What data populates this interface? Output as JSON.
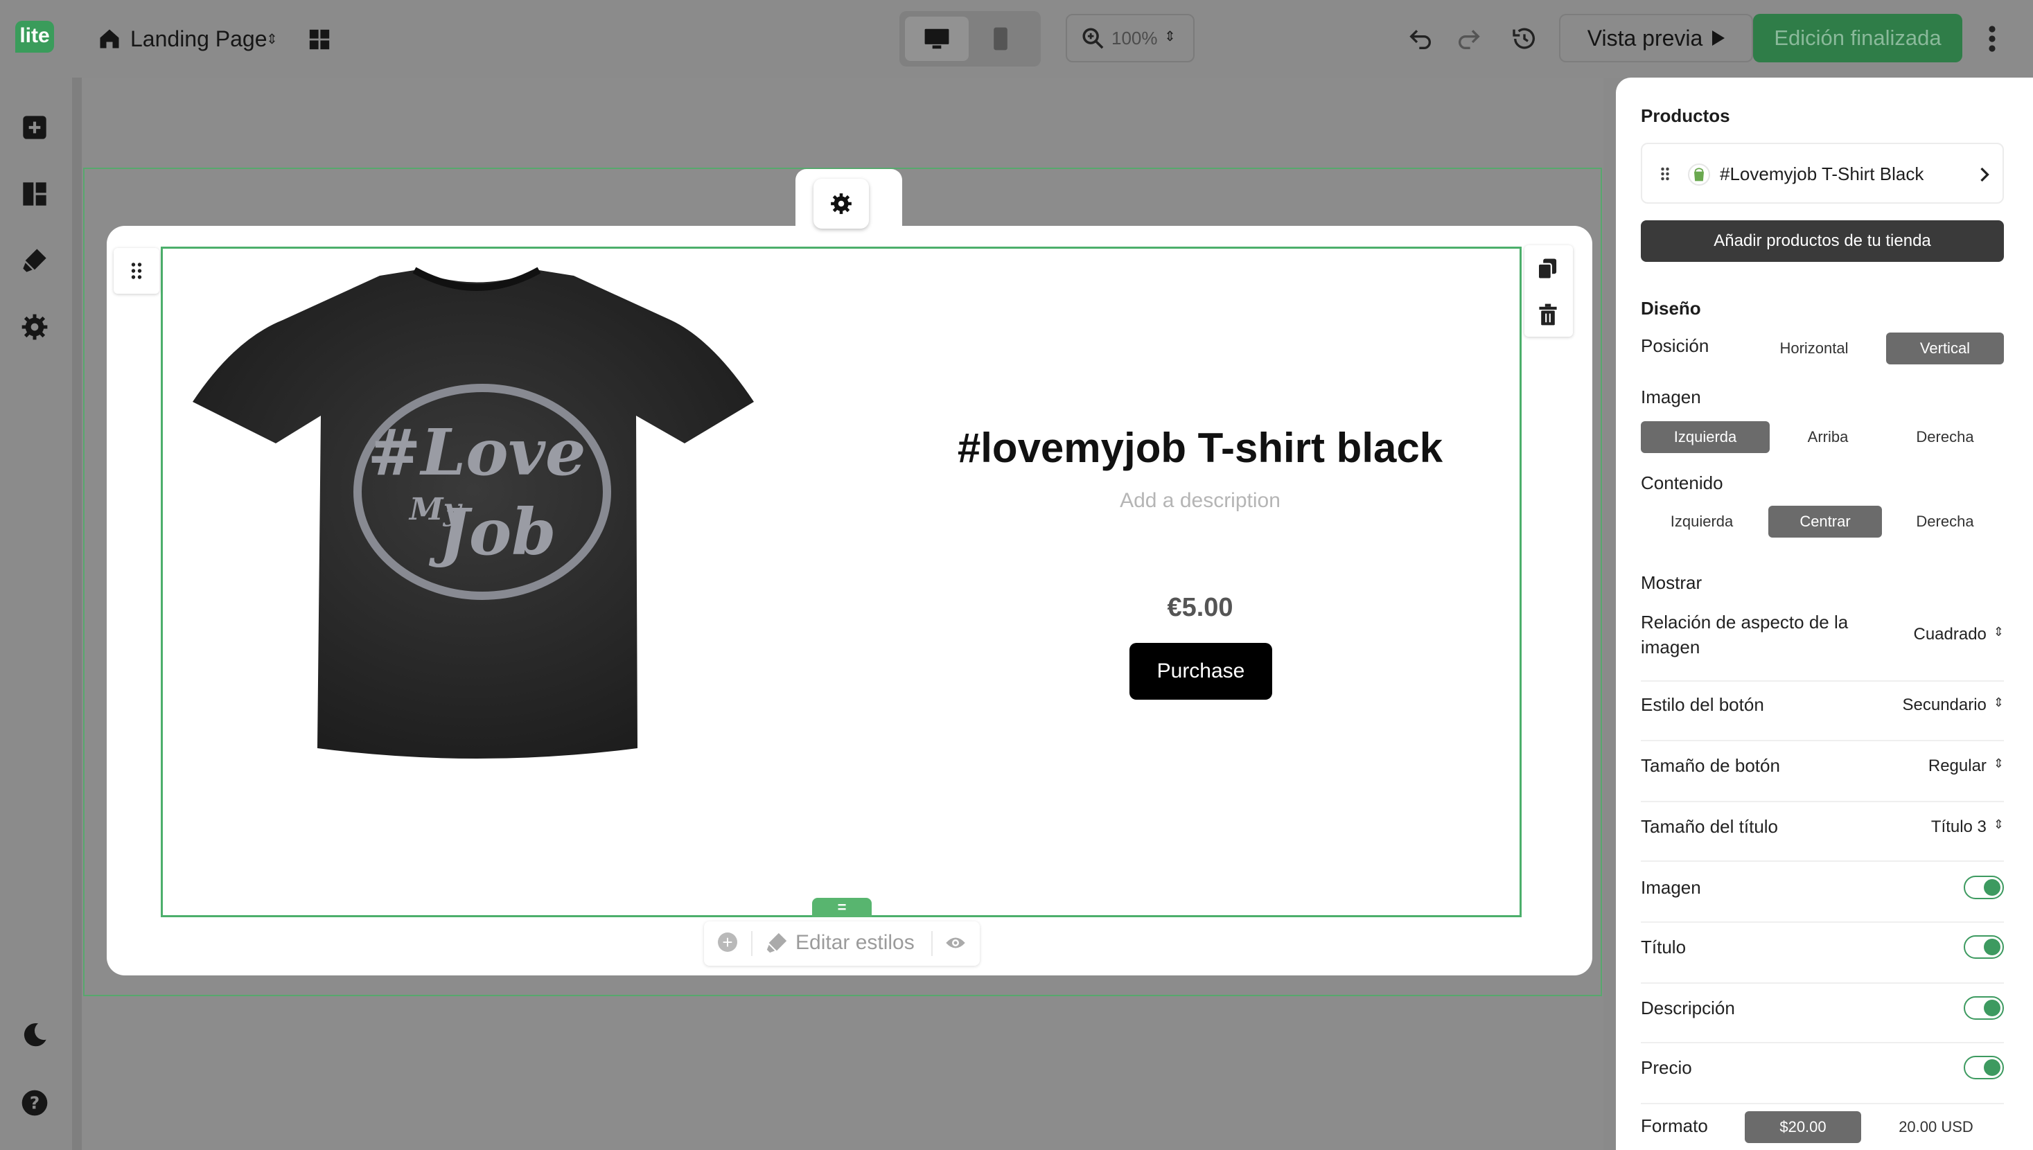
{
  "topbar": {
    "logo": "lite",
    "page_name": "Landing Page",
    "zoom": "100%",
    "preview_label": "Vista previa",
    "done_label": "Edición finalizada"
  },
  "canvas": {
    "product_title": "#lovemyjob T-shirt black",
    "description_placeholder": "Add a description",
    "price": "€5.00",
    "purchase_label": "Purchase",
    "resize_handle": "=",
    "edit_styles_label": "Editar estilos"
  },
  "panel": {
    "products_heading": "Productos",
    "product_item": "#Lovemyjob T-Shirt Black",
    "add_products_label": "Añadir productos de tu tienda",
    "design_heading": "Diseño",
    "position_label": "Posición",
    "position_options": [
      "Horizontal",
      "Vertical"
    ],
    "position_selected": "Vertical",
    "image_label": "Imagen",
    "image_options": [
      "Izquierda",
      "Arriba",
      "Derecha"
    ],
    "image_selected": "Izquierda",
    "content_label": "Contenido",
    "content_options": [
      "Izquierda",
      "Centrar",
      "Derecha"
    ],
    "content_selected": "Centrar",
    "show_heading": "Mostrar",
    "aspect_label": "Relación de aspecto de la imagen",
    "aspect_value": "Cuadrado",
    "button_style_label": "Estilo del botón",
    "button_style_value": "Secundario",
    "button_size_label": "Tamaño de botón",
    "button_size_value": "Regular",
    "title_size_label": "Tamaño del título",
    "title_size_value": "Título 3",
    "toggles": [
      {
        "label": "Imagen",
        "on": true
      },
      {
        "label": "Título",
        "on": true
      },
      {
        "label": "Descripción",
        "on": true
      },
      {
        "label": "Precio",
        "on": true
      }
    ],
    "format_label": "Formato",
    "format_options": [
      "$20.00",
      "20.00 USD"
    ],
    "format_selected": "$20.00"
  },
  "colors": {
    "accent_green": "#3a9c5b",
    "outline_green": "#4caf6b",
    "overlay_gray": "#8a8a8a"
  }
}
